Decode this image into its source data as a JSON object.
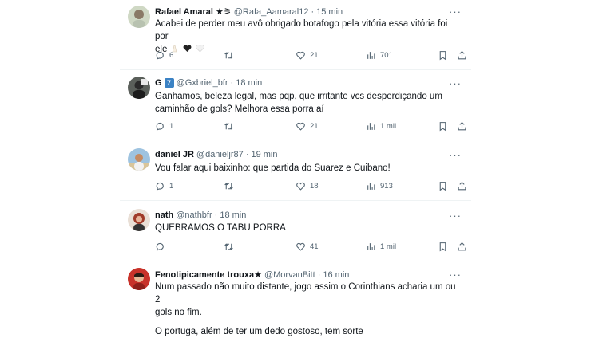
{
  "tweets": [
    {
      "name": "Rafael Amaral ★⚞",
      "handle": "@Rafa_Aamaral12",
      "dot": "·",
      "time": "15 min",
      "text_line1": "Acabei de perder meu avô obrigado botafogo pela vitória essa vitória foi por",
      "text_line2": "ele",
      "text_emojis": [
        "folded-hands",
        "black-heart",
        "white-heart"
      ],
      "replies": "6",
      "retweets": "",
      "likes": "21",
      "views": "701"
    },
    {
      "name": "G",
      "name_badge": "7",
      "handle": "@Gxbriel_bfr",
      "dot": "·",
      "time": "18 min",
      "text_line1": "Ganhamos, beleza legal, mas pqp, que irritante vcs desperdiçando um",
      "text_line2": "caminhão de gols? Melhora essa porra aí",
      "replies": "1",
      "retweets": "",
      "likes": "21",
      "views": "1 mil"
    },
    {
      "name": "daniel JR",
      "handle": "@danieljr87",
      "dot": "·",
      "time": "19 min",
      "text_line1": "Vou falar aqui baixinho: que partida do Suarez e Cuibano!",
      "replies": "1",
      "retweets": "",
      "likes": "18",
      "views": "913"
    },
    {
      "name": "nath",
      "handle": "@nathbfr",
      "dot": "·",
      "time": "18 min",
      "text_line1": "QUEBRAMOS O TABU PORRA",
      "replies": "",
      "retweets": "",
      "likes": "41",
      "views": "1 mil"
    },
    {
      "name": "Fenotipicamente trouxa★",
      "handle": "@MorvanBitt",
      "dot": "·",
      "time": "16 min",
      "text_line1": "Num passado não muito distante, jogo assim o Corinthians acharia um ou 2",
      "text_line2": "gols no fim.",
      "text_line3": "O portuga, além de ter um dedo gostoso, tem sorte"
    }
  ],
  "more_label": "···",
  "colors": {
    "text": "#0f1419",
    "secondary": "#536471",
    "divider": "#eff3f4"
  }
}
